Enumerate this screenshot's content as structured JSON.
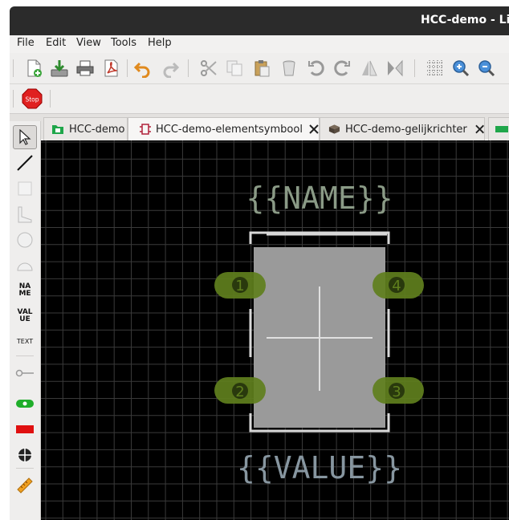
{
  "window": {
    "title": "HCC-demo - Lib"
  },
  "menu": [
    "File",
    "Edit",
    "View",
    "Tools",
    "Help"
  ],
  "toolbar": {
    "icons": [
      "new-file-icon",
      "save-icon",
      "print-icon",
      "export-pdf-icon",
      "undo-icon",
      "redo-icon",
      "cut-icon",
      "copy-icon",
      "paste-icon",
      "delete-icon",
      "rotate-ccw-icon",
      "rotate-cw-icon",
      "mirror-horizontal-icon",
      "mirror-vertical-icon",
      "grid-icon",
      "zoom-in-icon",
      "zoom-out-icon"
    ],
    "stop_label": "Stop"
  },
  "tabs": [
    {
      "label": "HCC-demo",
      "icon": "folder-icon",
      "closable": false
    },
    {
      "label": "HCC-demo-elementsymbool",
      "icon": "component-icon",
      "closable": true
    },
    {
      "label": "HCC-demo-gelijkrichter",
      "icon": "package-icon",
      "closable": true
    }
  ],
  "side_tools": {
    "name_label": "NA\nME",
    "value_label": "VAL\nUE",
    "text_label": "TEXT"
  },
  "canvas": {
    "name_placeholder": "{{NAME}}",
    "value_placeholder": "{{VALUE}}",
    "pads": [
      "1",
      "4",
      "2",
      "3"
    ]
  },
  "colors": {
    "background": "#000000",
    "grid": "#3a3a3a",
    "pad": "#5f7f1d",
    "body": "#9a9a9a",
    "outline": "#d8d8d8",
    "name_text": "#8a9a86",
    "value_text": "#8796a0"
  }
}
